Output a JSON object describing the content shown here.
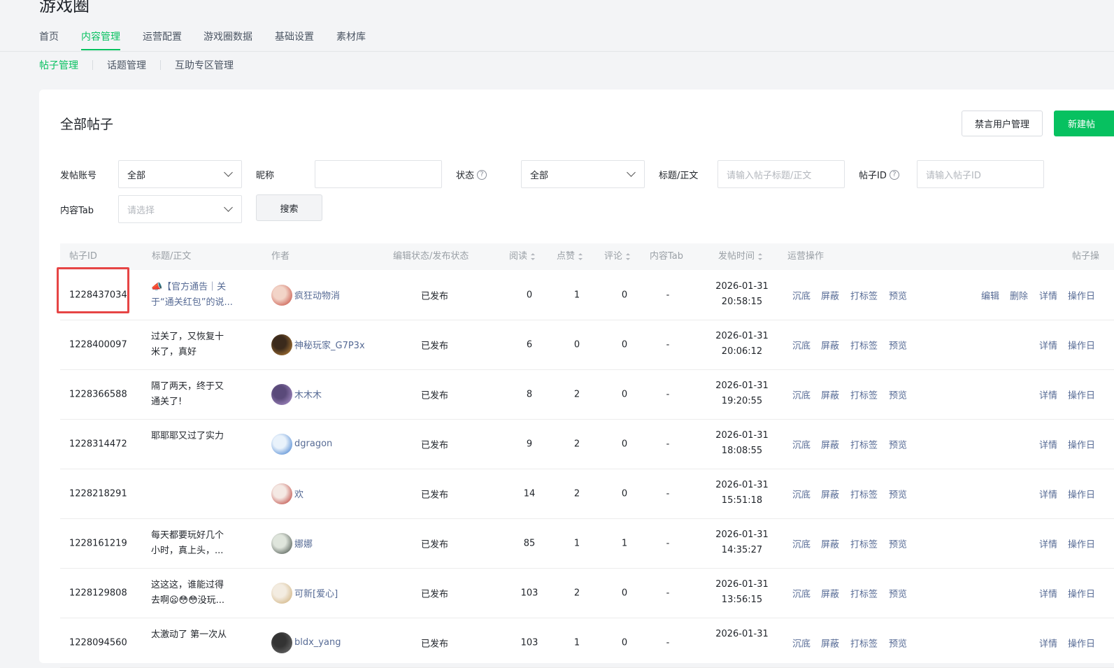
{
  "app": {
    "title": "游戏圈"
  },
  "nav": {
    "tabs": [
      {
        "label": "首页",
        "active": false
      },
      {
        "label": "内容管理",
        "active": true
      },
      {
        "label": "运营配置",
        "active": false
      },
      {
        "label": "游戏圈数据",
        "active": false
      },
      {
        "label": "基础设置",
        "active": false
      },
      {
        "label": "素材库",
        "active": false
      }
    ],
    "subtabs": [
      {
        "label": "帖子管理",
        "active": true
      },
      {
        "label": "话题管理",
        "active": false
      },
      {
        "label": "互助专区管理",
        "active": false
      }
    ]
  },
  "card": {
    "title": "全部帖子",
    "mute_button": "禁言用户管理",
    "new_post_button": "新建帖"
  },
  "filters": {
    "account_label": "发帖账号",
    "account_value": "全部",
    "nickname_label": "昵称",
    "nickname_value": "",
    "status_label": "状态",
    "status_value": "全部",
    "title_label": "标题/正文",
    "title_placeholder": "请输入帖子标题/正文",
    "postid_label": "帖子ID",
    "postid_placeholder": "请输入帖子ID",
    "tab_label": "内容Tab",
    "tab_placeholder": "请选择",
    "search_button": "搜索",
    "help_icon_glyph": "?"
  },
  "table": {
    "columns": [
      "帖子ID",
      "标题/正文",
      "作者",
      "编辑状态/发布状态",
      "阅读",
      "点赞",
      "评论",
      "内容Tab",
      "发帖时间",
      "运营操作",
      "帖子操"
    ],
    "ops": [
      "沉底",
      "屏蔽",
      "打标签",
      "预览"
    ],
    "post_ops_full": [
      "编辑",
      "删除",
      "详情",
      "操作日"
    ],
    "post_ops_short": [
      "详情",
      "操作日"
    ],
    "rows": [
      {
        "id": "1228437034",
        "title_lines": [
          "📣【官方通告｜关",
          "于“通关红包”的说..."
        ],
        "title_link": true,
        "author": "疯狂动物消",
        "avatar": [
          "#f2d4c8",
          "#c0392b"
        ],
        "status": "已发布",
        "read": "0",
        "like": "1",
        "comment": "0",
        "tab": "-",
        "date": "2026-01-31",
        "time": "20:58:15",
        "full_ops": true
      },
      {
        "id": "1228400097",
        "title_lines": [
          "过关了，又恢复十",
          "米了，真好"
        ],
        "title_link": false,
        "author": "神秘玩家_G7P3x",
        "avatar": [
          "#3b2a1c",
          "#c98b3b"
        ],
        "status": "已发布",
        "read": "6",
        "like": "0",
        "comment": "0",
        "tab": "-",
        "date": "2026-01-31",
        "time": "20:06:12",
        "full_ops": false
      },
      {
        "id": "1228366588",
        "title_lines": [
          "隔了两天，终于又",
          "通关了!"
        ],
        "title_link": false,
        "author": "木木木",
        "avatar": [
          "#5a4a7a",
          "#b79bd6"
        ],
        "status": "已发布",
        "read": "8",
        "like": "2",
        "comment": "0",
        "tab": "-",
        "date": "2026-01-31",
        "time": "19:20:55",
        "full_ops": false
      },
      {
        "id": "1228314472",
        "title_lines": [
          "耶耶耶又过了实力"
        ],
        "title_link": false,
        "author": "dgragon",
        "avatar": [
          "#e9f2fb",
          "#2a6fc9"
        ],
        "status": "已发布",
        "read": "9",
        "like": "2",
        "comment": "0",
        "tab": "-",
        "date": "2026-01-31",
        "time": "18:08:55",
        "full_ops": false
      },
      {
        "id": "1228218291",
        "title_lines": [],
        "title_link": false,
        "author": "欢",
        "avatar": [
          "#f4e9e4",
          "#b3261e"
        ],
        "status": "已发布",
        "read": "14",
        "like": "2",
        "comment": "0",
        "tab": "-",
        "date": "2026-01-31",
        "time": "15:51:18",
        "full_ops": false
      },
      {
        "id": "1228161219",
        "title_lines": [
          "每天都要玩好几个",
          "小时，真上头，..."
        ],
        "title_link": false,
        "author": "娜娜",
        "avatar": [
          "#dfe5dc",
          "#2f3a33"
        ],
        "status": "已发布",
        "read": "85",
        "like": "1",
        "comment": "1",
        "tab": "-",
        "date": "2026-01-31",
        "time": "14:35:27",
        "full_ops": false
      },
      {
        "id": "1228129808",
        "title_lines": [
          "这这这，谁能过得",
          "去啊😦😳😳没玩..."
        ],
        "title_link": false,
        "author": "可新[爱心]",
        "avatar": [
          "#f3ece1",
          "#c9a66b"
        ],
        "status": "已发布",
        "read": "103",
        "like": "2",
        "comment": "0",
        "tab": "-",
        "date": "2026-01-31",
        "time": "13:56:15",
        "full_ops": false
      },
      {
        "id": "1228094560",
        "title_lines": [
          "太激动了 第一次从"
        ],
        "title_link": false,
        "author": "bldx_yang",
        "avatar": [
          "#333333",
          "#777777"
        ],
        "status": "已发布",
        "read": "103",
        "like": "1",
        "comment": "0",
        "tab": "-",
        "date": "2026-01-31",
        "time": "",
        "full_ops": false
      }
    ]
  },
  "colors": {
    "accent": "#07c160",
    "link": "#576b95",
    "highlight": "#e64545"
  }
}
